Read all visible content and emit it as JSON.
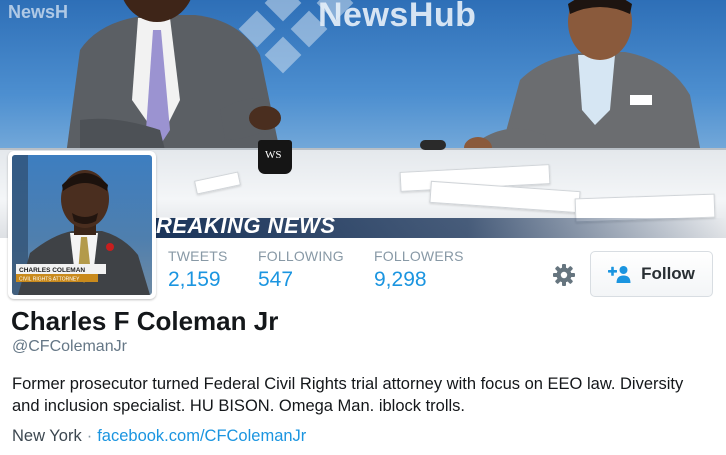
{
  "header": {
    "background_logo": "NewsHub",
    "background_logo_small": "NewsH",
    "mug_text": "WS",
    "banner_text": "REAKING NEWS"
  },
  "avatar": {
    "lower_third_name": "CHARLES COLEMAN",
    "lower_third_title": "CIVIL RIGHTS ATTORNEY"
  },
  "stats": [
    {
      "label": "TWEETS",
      "value": "2,159"
    },
    {
      "label": "FOLLOWING",
      "value": "547"
    },
    {
      "label": "FOLLOWERS",
      "value": "9,298"
    }
  ],
  "actions": {
    "settings_icon": "gear-icon",
    "follow_icon": "add-user-icon",
    "follow_label": "Follow"
  },
  "profile": {
    "name": "Charles F Coleman Jr",
    "handle": "@CFColemanJr",
    "bio": "Former prosecutor turned Federal Civil Rights trial attorney with focus on EEO law. Diversity and inclusion specialist. HU BISON. Omega Man. iblock trolls.",
    "location": "New York",
    "separator": "·",
    "website": "facebook.com/CFColemanJr"
  },
  "colors": {
    "link_blue": "#1b95e0",
    "muted_gray": "#8899a6",
    "text_dark": "#14171a"
  }
}
